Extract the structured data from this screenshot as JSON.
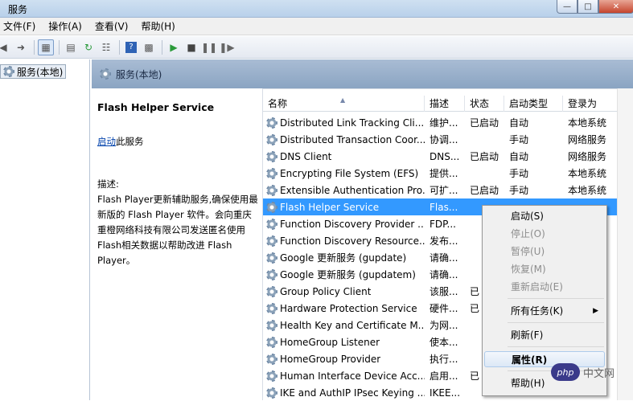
{
  "window": {
    "title": "服务"
  },
  "menubar": {
    "items": [
      "文件(F)",
      "操作(A)",
      "查看(V)",
      "帮助(H)"
    ]
  },
  "tree": {
    "root": "服务(本地)"
  },
  "header": {
    "title": "服务(本地)"
  },
  "detail": {
    "service_name": "Flash Helper Service",
    "start_link": "启动",
    "start_suffix": "此服务",
    "desc_label": "描述:",
    "description": "Flash Player更新辅助服务,确保使用最新版的 Flash Player 软件。会向重庆重橙网络科技有限公司发送匿名使用Flash相关数据以帮助改进 Flash Player。"
  },
  "columns": [
    "名称",
    "描述",
    "状态",
    "启动类型",
    "登录为"
  ],
  "services": [
    {
      "name": "Distributed Link Tracking Cli...",
      "desc": "维护...",
      "status": "已启动",
      "startup": "自动",
      "logon": "本地系统"
    },
    {
      "name": "Distributed Transaction Coor...",
      "desc": "协调...",
      "status": "",
      "startup": "手动",
      "logon": "网络服务"
    },
    {
      "name": "DNS Client",
      "desc": "DNS...",
      "status": "已启动",
      "startup": "自动",
      "logon": "网络服务"
    },
    {
      "name": "Encrypting File System (EFS)",
      "desc": "提供...",
      "status": "",
      "startup": "手动",
      "logon": "本地系统"
    },
    {
      "name": "Extensible Authentication Pro...",
      "desc": "可扩...",
      "status": "已启动",
      "startup": "手动",
      "logon": "本地系统"
    },
    {
      "name": "Flash Helper Service",
      "desc": "Flas...",
      "status": "",
      "startup": "",
      "logon": ""
    },
    {
      "name": "Function Discovery Provider ...",
      "desc": "FDP...",
      "status": "",
      "startup": "",
      "logon": ""
    },
    {
      "name": "Function Discovery Resource...",
      "desc": "发布...",
      "status": "",
      "startup": "",
      "logon": ""
    },
    {
      "name": "Google 更新服务 (gupdate)",
      "desc": "请确...",
      "status": "",
      "startup": "",
      "logon": ""
    },
    {
      "name": "Google 更新服务 (gupdatem)",
      "desc": "请确...",
      "status": "",
      "startup": "",
      "logon": ""
    },
    {
      "name": "Group Policy Client",
      "desc": "该服...",
      "status": "已",
      "startup": "",
      "logon": ""
    },
    {
      "name": "Hardware Protection Service",
      "desc": "硬件...",
      "status": "已",
      "startup": "",
      "logon": ""
    },
    {
      "name": "Health Key and Certificate M...",
      "desc": "为网...",
      "status": "",
      "startup": "",
      "logon": ""
    },
    {
      "name": "HomeGroup Listener",
      "desc": "使本...",
      "status": "",
      "startup": "",
      "logon": ""
    },
    {
      "name": "HomeGroup Provider",
      "desc": "执行...",
      "status": "",
      "startup": "",
      "logon": ""
    },
    {
      "name": "Human Interface Device Acc...",
      "desc": "启用...",
      "status": "已",
      "startup": "",
      "logon": ""
    },
    {
      "name": "IKE and AuthIP IPsec Keying ...",
      "desc": "IKEE...",
      "status": "",
      "startup": "",
      "logon": ""
    }
  ],
  "context_menu": {
    "start": "启动(S)",
    "stop": "停止(O)",
    "pause": "暂停(U)",
    "resume": "恢复(M)",
    "restart": "重新启动(E)",
    "all_tasks": "所有任务(K)",
    "refresh": "刷新(F)",
    "properties": "属性(R)",
    "help": "帮助(H)"
  },
  "watermark": {
    "logo": "php",
    "text": "中文网"
  }
}
